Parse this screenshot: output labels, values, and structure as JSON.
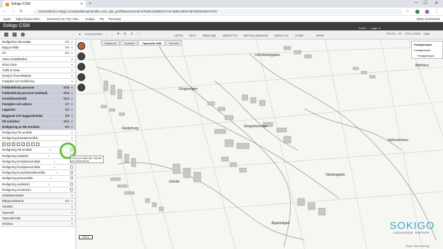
{
  "browser": {
    "tab_title": "Sokigo CSM",
    "url": "csm314demo.sokigo.com/spatialmap?profile=csm_dev_profile&sessionId=b7849C4008E9-07A8-4ZD5-9E03-5EF804E260CF67D",
    "back": "←",
    "forward": "→",
    "reload": "↻",
    "bookmarks_icon": "☆",
    "other_bookmarks": "Other bookmarks"
  },
  "bookmarks": [
    "Appar",
    "https://www.e5sh...",
    "Generell (AD TG) / Ms...",
    "Sokigo",
    "FB",
    "Personal"
  ],
  "app": {
    "title": "Sokigo CSM"
  },
  "modes": [
    "FAVORITER",
    "",
    "",
    "",
    "",
    ""
  ],
  "topmenu": [
    "HITTA",
    "RITA",
    "REDLINE",
    "VERKTYG",
    "INSTÄLLNINGAR",
    "SKRIV UT",
    "VYER",
    "",
    "APPS"
  ],
  "userlinks": [
    "Admin",
    "Logga ut"
  ],
  "rightlinks": [
    "PROFIL: HIT",
    "SITE ADMIN",
    "Hjälp"
  ],
  "basemap_tabs": [
    "Bakgrund",
    "Topkarta",
    "Topovektr DIM",
    "Ortofoto"
  ],
  "basemap_selected": 2,
  "sidebar": {
    "layers": [
      {
        "label": "Redigerbar demodata",
        "count": "0/2",
        "style": "w"
      },
      {
        "label": "Bygg & Miljö",
        "count": "0/9",
        "style": "w"
      },
      {
        "label": "GT",
        "count": "0/3",
        "style": "w"
      },
      {
        "label": "Allma Grävtillstånd",
        "count": "",
        "style": "w"
      },
      {
        "label": "Minut Gata",
        "count": "",
        "style": "w"
      },
      {
        "label": "Trafik & Gata",
        "count": "",
        "style": "w"
      },
      {
        "label": "Detalj & Översiktsplan",
        "count": "",
        "style": "w"
      },
      {
        "label": "Fastighet och befolkning",
        "count": "",
        "style": "w"
      },
      {
        "label": "Folkbokförda personer",
        "count": "0/26",
        "style": "hi"
      },
      {
        "label": "Folkbokförda personer (Utökad)",
        "count": "0/26",
        "style": "hi"
      },
      {
        "label": "Inomåldsstatistik",
        "count": "0/12",
        "style": "hi"
      },
      {
        "label": "Fastighet och adress",
        "count": "1/7",
        "style": "hi"
      },
      {
        "label": "Lägenhet",
        "count": "0/2",
        "style": "hi"
      },
      {
        "label": "Byggnad och byggnadsdelar",
        "count": "0/9",
        "style": "hi"
      },
      {
        "label": "FB områden",
        "count": "0/11",
        "style": "hi"
      },
      {
        "label": "Redigering av FB områden",
        "count": "0/3",
        "style": "hi"
      },
      {
        "label": "Redigering FB område",
        "count": "",
        "style": "w"
      },
      {
        "label": "Redigering Bostadsområde",
        "count": "",
        "style": "w"
      }
    ],
    "layers2": [
      {
        "label": "Redigering FB område"
      },
      {
        "label": "Redigering stadsdel"
      },
      {
        "label": "Redigering hemtjänstområde"
      },
      {
        "label": "Redigering hemtjänstområde"
      },
      {
        "label": "Redigering huvudstatistikområde"
      },
      {
        "label": "Redigering planområde"
      },
      {
        "label": "Redigering valdistrikt"
      },
      {
        "label": "Redigering invatorium"
      }
    ],
    "groups": [
      {
        "label": "Gatstatusmarker",
        "count": ""
      },
      {
        "label": "Bakgrundskartor",
        "count": "1/4"
      },
      {
        "label": "Saolaris",
        "count": ""
      },
      {
        "label": "Topovekt",
        "count": ""
      },
      {
        "label": "Topovekt DIM",
        "count": ""
      },
      {
        "label": "Ortofoto",
        "count": ""
      }
    ]
  },
  "panel": {
    "title": "Fastighetsyta",
    "items": [
      "Fastighetsyta",
      "Fastighetsyta"
    ]
  },
  "tooltip": "Tänd och släck alla. Välj alla för tända lamnat",
  "map_labels": [
    "Värmlandsgatan",
    "Skogsblomman",
    "Skogsstigen",
    "Björkhus",
    "Fjäderborg",
    "Tobaksgatan",
    "Gärdet",
    "Äppelvägen",
    "Nattsvärmare"
  ],
  "scale": "200 m",
  "logo": {
    "name": "SOKIGO",
    "sub": "ADDNODE GROUP"
  },
  "status": "Skapt: Sida Hardning"
}
